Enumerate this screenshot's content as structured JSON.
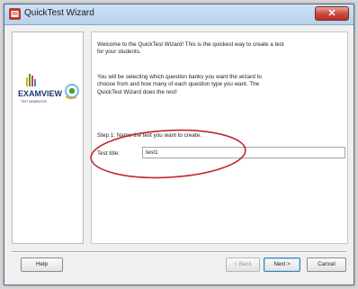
{
  "window": {
    "title": "QuickTest Wizard",
    "close_glyph": "✕"
  },
  "sidebar": {
    "logo_text": "EXAMVIEW",
    "logo_subtext": "TEST GENERATOR"
  },
  "content": {
    "intro": "Welcome to the QuickTest Wizard!  This is the quickest way to create a test\nfor your students.",
    "description": "You will be selecting which question banks you want the wizard to\nchoose from and how many of each question type you want.  The\nQuickTest Wizard does the rest!",
    "step_text": "Step 1:  Name the test you want to create.",
    "test_title_label": "Test title:",
    "test_title_value": "test1"
  },
  "buttons": {
    "help": "Help",
    "back": "< Back",
    "next": "Next >",
    "cancel": "Cancel"
  },
  "colors": {
    "annotation": "#c0282d",
    "title_bar": "#b6d0ea",
    "close": "#c8463a"
  }
}
